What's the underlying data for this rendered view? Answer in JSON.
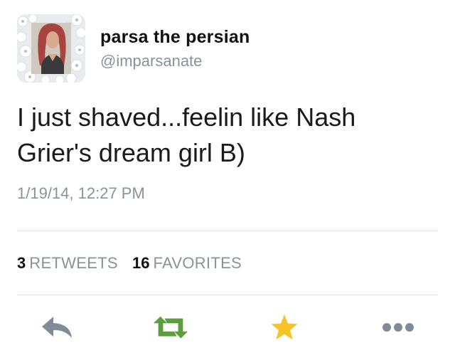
{
  "tweet": {
    "display_name": "parsa the persian",
    "handle": "@imparsanate",
    "text": "I just shaved...feelin like Nash Grier's dream girl B)",
    "timestamp": "1/19/14, 12:27 PM"
  },
  "stats": {
    "retweets_count": "3",
    "retweets_label": "RETWEETS",
    "favorites_count": "16",
    "favorites_label": "FAVORITES"
  },
  "actions": [
    {
      "name": "reply",
      "icon": "reply-icon",
      "color": "#7f8b96"
    },
    {
      "name": "retweet",
      "icon": "retweet-icon",
      "color": "#5c9e3e"
    },
    {
      "name": "favorite",
      "icon": "star-icon",
      "color": "#f6c324"
    },
    {
      "name": "more",
      "icon": "more-icon",
      "color": "#7f8b96"
    }
  ],
  "colors": {
    "text_primary": "#111111",
    "text_secondary": "#8a9299",
    "divider": "#e1e4e6",
    "retweet_green": "#5c9e3e",
    "favorite_gold": "#f6c324"
  }
}
